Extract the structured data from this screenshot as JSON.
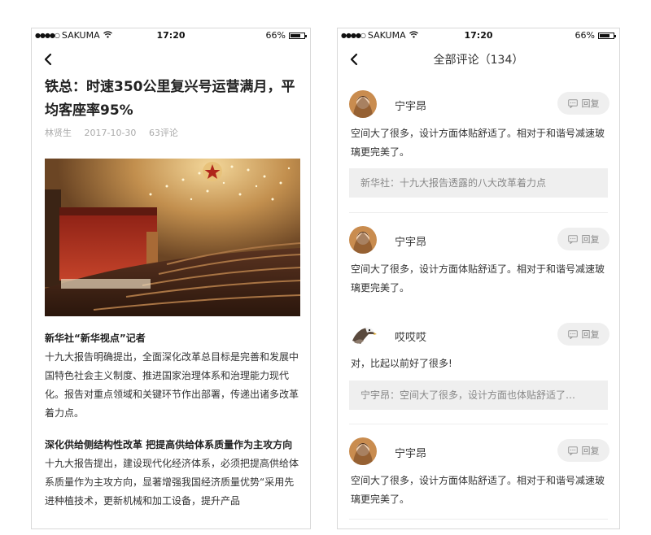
{
  "status_bar": {
    "signal_dots": "●●●●○",
    "carrier": "SAKUMA",
    "time": "17:20",
    "battery_percent": "66%",
    "battery_level": 0.66
  },
  "article": {
    "title": "铁总：时速350公里复兴号运营满月，平均客座率95%",
    "author": "林贤生",
    "date": "2017-10-30",
    "comment_count": "63评论",
    "sections": [
      {
        "heading": "新华社“新华视点”记者",
        "body": "十九大报告明确提出，全面深化改革总目标是完善和发展中国特色社会主义制度、推进国家治理体系和治理能力现代化。报告对重点领域和关键环节作出部署，传递出诸多改革着力点。"
      },
      {
        "heading": "深化供给侧结构性改革 把提高供给体系质量作为主攻方向",
        "body": "十九大报告提出，建设现代化经济体系，必须把提高供给体系质量作为主攻方向，显著增强我国经济质量优势“采用先进种植技术，更新机械和加工设备，提升产品"
      }
    ]
  },
  "comments_page": {
    "title": "全部评论（134）",
    "reply_label": "回复",
    "comments": [
      {
        "name": "宁宇昂",
        "text": "空间大了很多，设计方面体贴舒适了。相对于和谐号减速玻璃更完美了。",
        "quote": "新华社：十九大报告透露的八大改革着力点"
      },
      {
        "name": "宁宇昂",
        "text": "空间大了很多，设计方面体贴舒适了。相对于和谐号减速玻璃更完美了。"
      },
      {
        "name": "哎哎哎",
        "text": "对，比起以前好了很多!",
        "quote": "宁宇昂：空间大了很多，设计方面也体贴舒适了…"
      },
      {
        "name": "宁宇昂",
        "text": "空间大了很多，设计方面体贴舒适了。相对于和谐号减速玻璃更完美了。"
      }
    ]
  }
}
